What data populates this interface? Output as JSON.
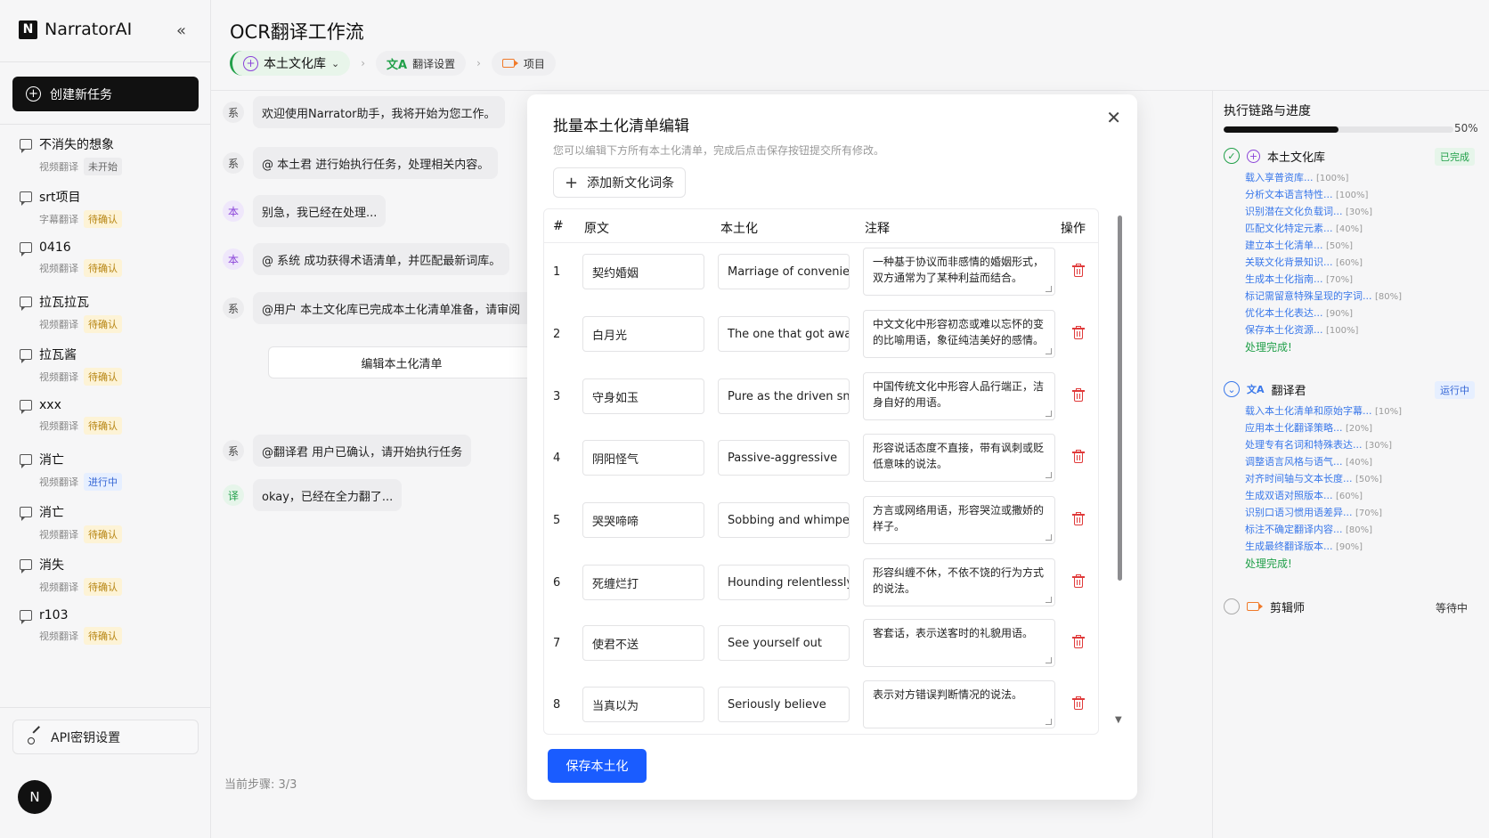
{
  "app": {
    "brand_letter": "N",
    "brand_name": "NarratorAI",
    "collapse_icon": "«",
    "create_label": "创建新任务",
    "api_label": "API密钥设置",
    "avatar_letter": "N"
  },
  "tasks": [
    {
      "name": "不消失的想象",
      "type": "视频翻译",
      "status": "未开始",
      "kind": "idle"
    },
    {
      "name": "srt项目",
      "type": "字幕翻译",
      "status": "待确认",
      "kind": "wait"
    },
    {
      "name": "0416",
      "type": "视频翻译",
      "status": "待确认",
      "kind": "wait"
    },
    {
      "name": "拉瓦拉瓦",
      "type": "视频翻译",
      "status": "待确认",
      "kind": "wait"
    },
    {
      "name": "拉瓦酱",
      "type": "视频翻译",
      "status": "待确认",
      "kind": "wait"
    },
    {
      "name": "xxx",
      "type": "视频翻译",
      "status": "待确认",
      "kind": "wait"
    },
    {
      "name": "消亡",
      "type": "视频翻译",
      "status": "进行中",
      "kind": "run"
    },
    {
      "name": "消亡",
      "type": "视频翻译",
      "status": "待确认",
      "kind": "wait"
    },
    {
      "name": "消失",
      "type": "视频翻译",
      "status": "待确认",
      "kind": "wait"
    },
    {
      "name": "r103",
      "type": "视频翻译",
      "status": "待确认",
      "kind": "wait"
    }
  ],
  "header": {
    "title": "OCR翻译工作流",
    "steps": [
      {
        "label": "本土文化库"
      },
      {
        "label": "翻译设置"
      },
      {
        "label": "项目"
      }
    ]
  },
  "chat": {
    "messages": [
      {
        "avatar": "系",
        "text": "欢迎使用Narrator助手，我将开始为您工作。"
      },
      {
        "avatar": "系",
        "text": "@ 本土君 进行始执行任务，处理相关内容。"
      },
      {
        "avatar": "本",
        "text": "别急，我已经在处理..."
      },
      {
        "avatar": "本",
        "text": "@ 系统 成功获得术语清单，并匹配最新词库。"
      },
      {
        "avatar": "系",
        "text": "@用户  本土文化库已完成本土化清单准备，请审阅"
      },
      {
        "avatar": "系",
        "text": "@翻译君 用户已确认，请开始执行任务"
      },
      {
        "avatar": "译",
        "text": "okay，已经在全力翻了..."
      }
    ],
    "edit_button": "编辑本土化清单",
    "current_step": "当前步骤: 3/3"
  },
  "modal": {
    "title": "批量本土化清单编辑",
    "description": "您可以编辑下方所有本土化清单，完成后点击保存按钮提交所有修改。",
    "add_label": "添加新文化词条",
    "columns": [
      "#",
      "原文",
      "本土化",
      "注释",
      "操作"
    ],
    "rows": [
      {
        "num": "1",
        "source": "契约婚姻",
        "local": "Marriage of convenie",
        "note": "一种基于协议而非感情的婚姻形式，双方通常为了某种利益而结合。"
      },
      {
        "num": "2",
        "source": "白月光",
        "local": "The one that got awa",
        "note": "中文文化中形容初恋或难以忘怀的变的比喻用语，象征纯洁美好的感情。"
      },
      {
        "num": "3",
        "source": "守身如玉",
        "local": "Pure as the driven sn",
        "note": "中国传统文化中形容人品行端正，洁身自好的用语。"
      },
      {
        "num": "4",
        "source": "阴阳怪气",
        "local": "Passive-aggressive",
        "note": "形容说话态度不直接，带有讽刺或贬低意味的说法。"
      },
      {
        "num": "5",
        "source": "哭哭啼啼",
        "local": "Sobbing and whimpe",
        "note": "方言或网络用语，形容哭泣或撒娇的样子。"
      },
      {
        "num": "6",
        "source": "死缠烂打",
        "local": "Hounding relentlessly",
        "note": "形容纠缠不休，不依不饶的行为方式的说法。"
      },
      {
        "num": "7",
        "source": "使君不送",
        "local": "See yourself out",
        "note": "客套话，表示送客时的礼貌用语。"
      },
      {
        "num": "8",
        "source": "当真以为",
        "local": "Seriously believe",
        "note": "表示对方错误判断情况的说法。"
      }
    ],
    "save_label": "保存本土化"
  },
  "progress": {
    "title": "执行链路与进度",
    "percent_label": "50%",
    "fraction": 0.5,
    "agents": [
      {
        "name": "本土文化库",
        "status": "已完成",
        "items": [
          {
            "text": "载入享普资库...",
            "pct": "[100%]"
          },
          {
            "text": "分析文本语言特性...",
            "pct": "[100%]"
          },
          {
            "text": "识别潜在文化负载词...",
            "pct": "[30%]"
          },
          {
            "text": "匹配文化特定元素...",
            "pct": "[40%]"
          },
          {
            "text": "建立本土化清单...",
            "pct": "[50%]"
          },
          {
            "text": "关联文化背景知识...",
            "pct": "[60%]"
          },
          {
            "text": "生成本土化指南...",
            "pct": "[70%]"
          },
          {
            "text": "标记需留意特殊呈现的字词...",
            "pct": "[80%]"
          },
          {
            "text": "优化本土化表达...",
            "pct": "[90%]"
          },
          {
            "text": "保存本土化资源...",
            "pct": "[100%]"
          }
        ],
        "done": "处理完成!"
      },
      {
        "name": "翻译君",
        "status": "运行中",
        "items": [
          {
            "text": "载入本土化清单和原始字幕...",
            "pct": "[10%]"
          },
          {
            "text": "应用本土化翻译策略...",
            "pct": "[20%]"
          },
          {
            "text": "处理专有名词和特殊表达...",
            "pct": "[30%]"
          },
          {
            "text": "调整语言风格与语气...",
            "pct": "[40%]"
          },
          {
            "text": "对齐时间轴与文本长度...",
            "pct": "[50%]"
          },
          {
            "text": "生成双语对照版本...",
            "pct": "[60%]"
          },
          {
            "text": "识别口语习惯用语差异...",
            "pct": "[70%]"
          },
          {
            "text": "标注不确定翻译内容...",
            "pct": "[80%]"
          },
          {
            "text": "生成最终翻译版本...",
            "pct": "[90%]"
          }
        ],
        "done": "处理完成!"
      },
      {
        "name": "剪辑师",
        "status": "等待中",
        "items": [],
        "done": ""
      }
    ]
  }
}
